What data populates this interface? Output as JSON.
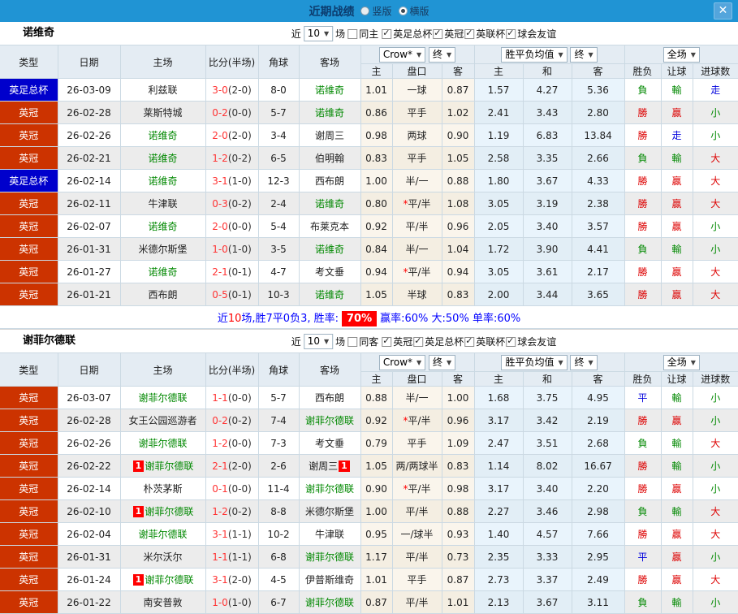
{
  "titlebar": {
    "title": "近期战绩",
    "vertical": "竖版",
    "horizontal": "横版",
    "close": "✕"
  },
  "table_labels": {
    "cols": [
      "类型",
      "日期",
      "主场",
      "比分(半场)",
      "角球",
      "客场"
    ],
    "subcols": [
      "主",
      "盘口",
      "客",
      "主",
      "和",
      "客",
      "胜负",
      "让球",
      "进球数"
    ],
    "selects": {
      "odds": "Crow*",
      "odds_final": "终",
      "avg": "胜平负均值",
      "avg_final": "终",
      "scope": "全场"
    }
  },
  "colors": {
    "topbar_blue": "#2094d4",
    "title_navy": "#0c3c6e",
    "league_red": "#cc3300",
    "league_blue": "#0000cc",
    "team_green": "#008800",
    "score_red": "#ff3333",
    "win_red": "#dd0000",
    "lose_green": "#008800",
    "draw_blue": "#0000dd",
    "summary_blue": "#0000ff",
    "highlight_red": "#ff0000"
  },
  "sections": [
    {
      "team": "诺维奇",
      "filter": {
        "near": "近",
        "count": "10",
        "games": "场",
        "same": "同主",
        "same_checked": false,
        "leagues": [
          "英足总杯",
          "英冠",
          "英联杯",
          "球会友谊"
        ]
      },
      "rows": [
        {
          "league": "英足总杯",
          "league_color": "blue",
          "date": "26-03-09",
          "home": "利兹联",
          "home_green": false,
          "home_card": false,
          "score_ft": "3-0",
          "score_ht": "(2-0)",
          "corners": "8-0",
          "away": "诺维奇",
          "away_green": true,
          "away_card": false,
          "odds_home": "1.01",
          "handicap": "一球",
          "handicap_star": false,
          "odds_away": "0.87",
          "avg_home": "1.57",
          "avg_draw": "4.27",
          "avg_away": "5.36",
          "result": "負",
          "handicap_result": "輸",
          "goals": "走"
        },
        {
          "league": "英冠",
          "league_color": "red",
          "date": "26-02-28",
          "home": "莱斯特城",
          "home_green": false,
          "home_card": false,
          "score_ft": "0-2",
          "score_ht": "(0-0)",
          "corners": "5-7",
          "away": "诺维奇",
          "away_green": true,
          "away_card": false,
          "odds_home": "0.86",
          "handicap": "平手",
          "handicap_star": false,
          "odds_away": "1.02",
          "avg_home": "2.41",
          "avg_draw": "3.43",
          "avg_away": "2.80",
          "result": "勝",
          "handicap_result": "贏",
          "goals": "小"
        },
        {
          "league": "英冠",
          "league_color": "red",
          "date": "26-02-26",
          "home": "诺维奇",
          "home_green": true,
          "home_card": false,
          "score_ft": "2-0",
          "score_ht": "(2-0)",
          "corners": "3-4",
          "away": "谢周三",
          "away_green": false,
          "away_card": false,
          "odds_home": "0.98",
          "handicap": "两球",
          "handicap_star": false,
          "odds_away": "0.90",
          "avg_home": "1.19",
          "avg_draw": "6.83",
          "avg_away": "13.84",
          "result": "勝",
          "handicap_result": "走",
          "goals": "小"
        },
        {
          "league": "英冠",
          "league_color": "red",
          "date": "26-02-21",
          "home": "诺维奇",
          "home_green": true,
          "home_card": false,
          "score_ft": "1-2",
          "score_ht": "(0-2)",
          "corners": "6-5",
          "away": "伯明翰",
          "away_green": false,
          "away_card": false,
          "odds_home": "0.83",
          "handicap": "平手",
          "handicap_star": false,
          "odds_away": "1.05",
          "avg_home": "2.58",
          "avg_draw": "3.35",
          "avg_away": "2.66",
          "result": "負",
          "handicap_result": "輸",
          "goals": "大"
        },
        {
          "league": "英足总杯",
          "league_color": "blue",
          "date": "26-02-14",
          "home": "诺维奇",
          "home_green": true,
          "home_card": false,
          "score_ft": "3-1",
          "score_ht": "(1-0)",
          "corners": "12-3",
          "away": "西布朗",
          "away_green": false,
          "away_card": false,
          "odds_home": "1.00",
          "handicap": "半/一",
          "handicap_star": false,
          "odds_away": "0.88",
          "avg_home": "1.80",
          "avg_draw": "3.67",
          "avg_away": "4.33",
          "result": "勝",
          "handicap_result": "贏",
          "goals": "大"
        },
        {
          "league": "英冠",
          "league_color": "red",
          "date": "26-02-11",
          "home": "牛津联",
          "home_green": false,
          "home_card": false,
          "score_ft": "0-3",
          "score_ht": "(0-2)",
          "corners": "2-4",
          "away": "诺维奇",
          "away_green": true,
          "away_card": false,
          "odds_home": "0.80",
          "handicap": "平/半",
          "handicap_star": true,
          "odds_away": "1.08",
          "avg_home": "3.05",
          "avg_draw": "3.19",
          "avg_away": "2.38",
          "result": "勝",
          "handicap_result": "贏",
          "goals": "大"
        },
        {
          "league": "英冠",
          "league_color": "red",
          "date": "26-02-07",
          "home": "诺维奇",
          "home_green": true,
          "home_card": false,
          "score_ft": "2-0",
          "score_ht": "(0-0)",
          "corners": "5-4",
          "away": "布莱克本",
          "away_green": false,
          "away_card": false,
          "odds_home": "0.92",
          "handicap": "平/半",
          "handicap_star": false,
          "odds_away": "0.96",
          "avg_home": "2.05",
          "avg_draw": "3.40",
          "avg_away": "3.57",
          "result": "勝",
          "handicap_result": "贏",
          "goals": "小"
        },
        {
          "league": "英冠",
          "league_color": "red",
          "date": "26-01-31",
          "home": "米德尔斯堡",
          "home_green": false,
          "home_card": false,
          "score_ft": "1-0",
          "score_ht": "(1-0)",
          "corners": "3-5",
          "away": "诺维奇",
          "away_green": true,
          "away_card": false,
          "odds_home": "0.84",
          "handicap": "半/一",
          "handicap_star": false,
          "odds_away": "1.04",
          "avg_home": "1.72",
          "avg_draw": "3.90",
          "avg_away": "4.41",
          "result": "負",
          "handicap_result": "輸",
          "goals": "小"
        },
        {
          "league": "英冠",
          "league_color": "red",
          "date": "26-01-27",
          "home": "诺维奇",
          "home_green": true,
          "home_card": false,
          "score_ft": "2-1",
          "score_ht": "(0-1)",
          "corners": "4-7",
          "away": "考文垂",
          "away_green": false,
          "away_card": false,
          "odds_home": "0.94",
          "handicap": "平/半",
          "handicap_star": true,
          "odds_away": "0.94",
          "avg_home": "3.05",
          "avg_draw": "3.61",
          "avg_away": "2.17",
          "result": "勝",
          "handicap_result": "贏",
          "goals": "大"
        },
        {
          "league": "英冠",
          "league_color": "red",
          "date": "26-01-21",
          "home": "西布朗",
          "home_green": false,
          "home_card": false,
          "score_ft": "0-5",
          "score_ht": "(0-1)",
          "corners": "10-3",
          "away": "诺维奇",
          "away_green": true,
          "away_card": false,
          "odds_home": "1.05",
          "handicap": "半球",
          "handicap_star": false,
          "odds_away": "0.83",
          "avg_home": "2.00",
          "avg_draw": "3.44",
          "avg_away": "3.65",
          "result": "勝",
          "handicap_result": "贏",
          "goals": "大"
        }
      ],
      "summary": {
        "parts": [
          {
            "text": "近",
            "style": "blue"
          },
          {
            "text": "10",
            "style": "red"
          },
          {
            "text": "场,胜7平0负3, 胜率:",
            "style": "blue"
          },
          {
            "text": "70%",
            "style": "badge"
          },
          {
            "text": "赢率:60% 大:50% 单率:60%",
            "style": "blue"
          }
        ]
      }
    },
    {
      "team": "谢菲尔德联",
      "filter": {
        "near": "近",
        "count": "10",
        "games": "场",
        "same": "同客",
        "same_checked": false,
        "leagues": [
          "英冠",
          "英足总杯",
          "英联杯",
          "球会友谊"
        ]
      },
      "rows": [
        {
          "league": "英冠",
          "league_color": "red",
          "date": "26-03-07",
          "home": "谢菲尔德联",
          "home_green": true,
          "home_card": false,
          "score_ft": "1-1",
          "score_ht": "(0-0)",
          "corners": "5-7",
          "away": "西布朗",
          "away_green": false,
          "away_card": false,
          "odds_home": "0.88",
          "handicap": "半/一",
          "handicap_star": false,
          "odds_away": "1.00",
          "avg_home": "1.68",
          "avg_draw": "3.75",
          "avg_away": "4.95",
          "result": "平",
          "handicap_result": "輸",
          "goals": "小"
        },
        {
          "league": "英冠",
          "league_color": "red",
          "date": "26-02-28",
          "home": "女王公园巡游者",
          "home_green": false,
          "home_card": false,
          "score_ft": "0-2",
          "score_ht": "(0-2)",
          "corners": "7-4",
          "away": "谢菲尔德联",
          "away_green": true,
          "away_card": false,
          "odds_home": "0.92",
          "handicap": "平/半",
          "handicap_star": true,
          "odds_away": "0.96",
          "avg_home": "3.17",
          "avg_draw": "3.42",
          "avg_away": "2.19",
          "result": "勝",
          "handicap_result": "贏",
          "goals": "小"
        },
        {
          "league": "英冠",
          "league_color": "red",
          "date": "26-02-26",
          "home": "谢菲尔德联",
          "home_green": true,
          "home_card": false,
          "score_ft": "1-2",
          "score_ht": "(0-0)",
          "corners": "7-3",
          "away": "考文垂",
          "away_green": false,
          "away_card": false,
          "odds_home": "0.79",
          "handicap": "平手",
          "handicap_star": false,
          "odds_away": "1.09",
          "avg_home": "2.47",
          "avg_draw": "3.51",
          "avg_away": "2.68",
          "result": "負",
          "handicap_result": "輸",
          "goals": "大"
        },
        {
          "league": "英冠",
          "league_color": "red",
          "date": "26-02-22",
          "home": "谢菲尔德联",
          "home_green": true,
          "home_card": true,
          "score_ft": "2-1",
          "score_ht": "(2-0)",
          "corners": "2-6",
          "away": "谢周三",
          "away_green": false,
          "away_card": true,
          "odds_home": "1.05",
          "handicap": "两/两球半",
          "handicap_star": false,
          "odds_away": "0.83",
          "avg_home": "1.14",
          "avg_draw": "8.02",
          "avg_away": "16.67",
          "result": "勝",
          "handicap_result": "輸",
          "goals": "小"
        },
        {
          "league": "英冠",
          "league_color": "red",
          "date": "26-02-14",
          "home": "朴茨茅斯",
          "home_green": false,
          "home_card": false,
          "score_ft": "0-1",
          "score_ht": "(0-0)",
          "corners": "11-4",
          "away": "谢菲尔德联",
          "away_green": true,
          "away_card": false,
          "odds_home": "0.90",
          "handicap": "平/半",
          "handicap_star": true,
          "odds_away": "0.98",
          "avg_home": "3.17",
          "avg_draw": "3.40",
          "avg_away": "2.20",
          "result": "勝",
          "handicap_result": "贏",
          "goals": "小"
        },
        {
          "league": "英冠",
          "league_color": "red",
          "date": "26-02-10",
          "home": "谢菲尔德联",
          "home_green": true,
          "home_card": true,
          "score_ft": "1-2",
          "score_ht": "(0-2)",
          "corners": "8-8",
          "away": "米德尔斯堡",
          "away_green": false,
          "away_card": false,
          "odds_home": "1.00",
          "handicap": "平/半",
          "handicap_star": false,
          "odds_away": "0.88",
          "avg_home": "2.27",
          "avg_draw": "3.46",
          "avg_away": "2.98",
          "result": "負",
          "handicap_result": "輸",
          "goals": "大"
        },
        {
          "league": "英冠",
          "league_color": "red",
          "date": "26-02-04",
          "home": "谢菲尔德联",
          "home_green": true,
          "home_card": false,
          "score_ft": "3-1",
          "score_ht": "(1-1)",
          "corners": "10-2",
          "away": "牛津联",
          "away_green": false,
          "away_card": false,
          "odds_home": "0.95",
          "handicap": "一/球半",
          "handicap_star": false,
          "odds_away": "0.93",
          "avg_home": "1.40",
          "avg_draw": "4.57",
          "avg_away": "7.66",
          "result": "勝",
          "handicap_result": "贏",
          "goals": "大"
        },
        {
          "league": "英冠",
          "league_color": "red",
          "date": "26-01-31",
          "home": "米尔沃尔",
          "home_green": false,
          "home_card": false,
          "score_ft": "1-1",
          "score_ht": "(1-1)",
          "corners": "6-8",
          "away": "谢菲尔德联",
          "away_green": true,
          "away_card": false,
          "odds_home": "1.17",
          "handicap": "平/半",
          "handicap_star": false,
          "odds_away": "0.73",
          "avg_home": "2.35",
          "avg_draw": "3.33",
          "avg_away": "2.95",
          "result": "平",
          "handicap_result": "贏",
          "goals": "小"
        },
        {
          "league": "英冠",
          "league_color": "red",
          "date": "26-01-24",
          "home": "谢菲尔德联",
          "home_green": true,
          "home_card": true,
          "score_ft": "3-1",
          "score_ht": "(2-0)",
          "corners": "4-5",
          "away": "伊普斯维奇",
          "away_green": false,
          "away_card": false,
          "odds_home": "1.01",
          "handicap": "平手",
          "handicap_star": false,
          "odds_away": "0.87",
          "avg_home": "2.73",
          "avg_draw": "3.37",
          "avg_away": "2.49",
          "result": "勝",
          "handicap_result": "贏",
          "goals": "大"
        },
        {
          "league": "英冠",
          "league_color": "red",
          "date": "26-01-22",
          "home": "南安普敦",
          "home_green": false,
          "home_card": false,
          "score_ft": "1-0",
          "score_ht": "(1-0)",
          "corners": "6-7",
          "away": "谢菲尔德联",
          "away_green": true,
          "away_card": false,
          "odds_home": "0.87",
          "handicap": "平/半",
          "handicap_star": false,
          "odds_away": "1.01",
          "avg_home": "2.13",
          "avg_draw": "3.67",
          "avg_away": "3.11",
          "result": "負",
          "handicap_result": "輸",
          "goals": "小"
        }
      ],
      "summary": null
    }
  ]
}
